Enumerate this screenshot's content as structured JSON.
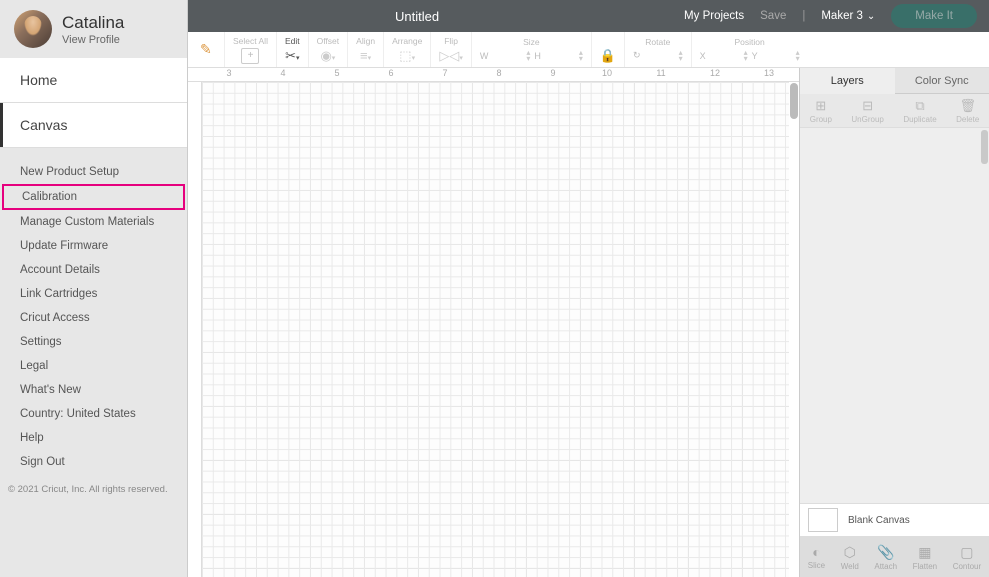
{
  "profile": {
    "name": "Catalina",
    "view": "View Profile"
  },
  "nav": {
    "primary": [
      {
        "label": "Home",
        "active": false
      },
      {
        "label": "Canvas",
        "active": true
      }
    ],
    "secondary": [
      {
        "label": "New Product Setup"
      },
      {
        "label": "Calibration",
        "highlight": true
      },
      {
        "label": "Manage Custom Materials"
      },
      {
        "label": "Update Firmware"
      },
      {
        "label": "Account Details"
      },
      {
        "label": "Link Cartridges"
      },
      {
        "label": "Cricut Access"
      },
      {
        "label": "Settings"
      },
      {
        "label": "Legal"
      },
      {
        "label": "What's New"
      },
      {
        "label": "Country: United States"
      },
      {
        "label": "Help"
      },
      {
        "label": "Sign Out"
      }
    ],
    "copyright": "© 2021 Cricut, Inc. All rights reserved."
  },
  "topbar": {
    "title": "Untitled",
    "my_projects": "My Projects",
    "save": "Save",
    "machine": "Maker 3",
    "make_it": "Make It"
  },
  "tools": {
    "select_all": "Select All",
    "edit": "Edit",
    "offset": "Offset",
    "align": "Align",
    "arrange": "Arrange",
    "flip": "Flip",
    "size": "Size",
    "size_w": "W",
    "size_h": "H",
    "lock": "🔒",
    "rotate": "Rotate",
    "position": "Position",
    "pos_x": "X",
    "pos_y": "Y"
  },
  "ruler": {
    "ticks": [
      "3",
      "4",
      "5",
      "6",
      "7",
      "8",
      "9",
      "10",
      "11",
      "12",
      "13"
    ]
  },
  "right": {
    "tabs": {
      "layers": "Layers",
      "color_sync": "Color Sync"
    },
    "layer_actions": {
      "group": "Group",
      "ungroup": "UnGroup",
      "duplicate": "Duplicate",
      "delete": "Delete"
    },
    "blank_canvas": "Blank Canvas",
    "bottom_actions": {
      "slice": "Slice",
      "weld": "Weld",
      "attach": "Attach",
      "flatten": "Flatten",
      "contour": "Contour"
    }
  }
}
